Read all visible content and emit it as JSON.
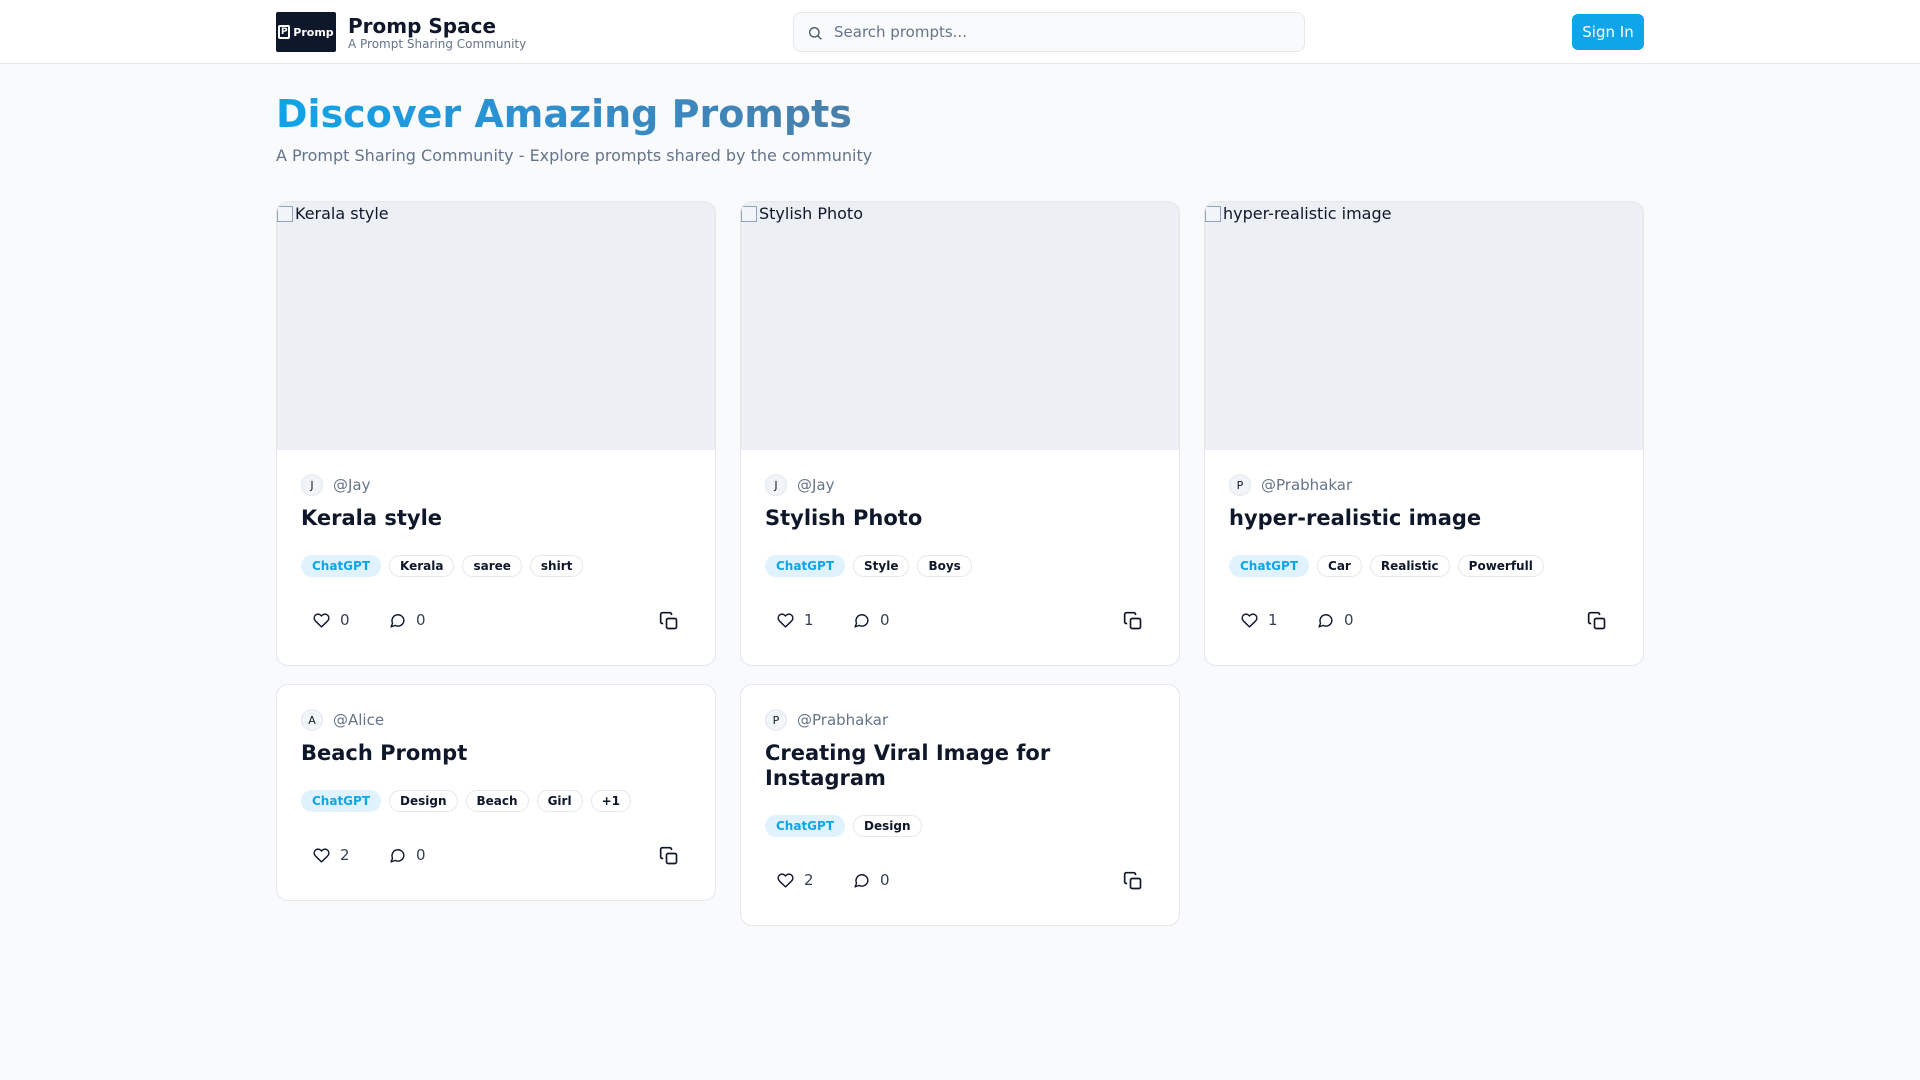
{
  "header": {
    "logo_text": "Promp",
    "brand_title": "Promp Space",
    "brand_subtitle": "A Prompt Sharing Community",
    "search_placeholder": "Search prompts...",
    "signin_label": "Sign In"
  },
  "hero": {
    "title": "Discover Amazing Prompts",
    "subtitle": "A Prompt Sharing Community - Explore prompts shared by the community"
  },
  "cards": [
    {
      "image_alt": "Kerala style",
      "avatar": "J",
      "handle": "@Jay",
      "title": "Kerala style",
      "tags": [
        "ChatGPT",
        "Kerala",
        "saree",
        "shirt"
      ],
      "likes": "0",
      "comments": "0"
    },
    {
      "image_alt": "Stylish Photo",
      "avatar": "J",
      "handle": "@Jay",
      "title": "Stylish Photo",
      "tags": [
        "ChatGPT",
        "Style",
        "Boys"
      ],
      "likes": "1",
      "comments": "0"
    },
    {
      "image_alt": "hyper-realistic image",
      "avatar": "P",
      "handle": "@Prabhakar",
      "title": "hyper-realistic image",
      "tags": [
        "ChatGPT",
        "Car",
        "Realistic",
        "Powerfull"
      ],
      "likes": "1",
      "comments": "0"
    },
    {
      "avatar": "A",
      "handle": "@Alice",
      "title": "Beach Prompt",
      "tags": [
        "ChatGPT",
        "Design",
        "Beach",
        "Girl",
        "+1"
      ],
      "likes": "2",
      "comments": "0"
    },
    {
      "avatar": "P",
      "handle": "@Prabhakar",
      "title": "Creating Viral Image for Instagram",
      "tags": [
        "ChatGPT",
        "Design"
      ],
      "likes": "2",
      "comments": "0"
    }
  ],
  "icons": {
    "search": "search-icon",
    "like": "heart-icon",
    "comment": "message-circle-icon",
    "copy": "copy-icon"
  },
  "colors": {
    "accent": "#0ea5e9",
    "text": "#0f172a",
    "muted": "#64748b"
  }
}
